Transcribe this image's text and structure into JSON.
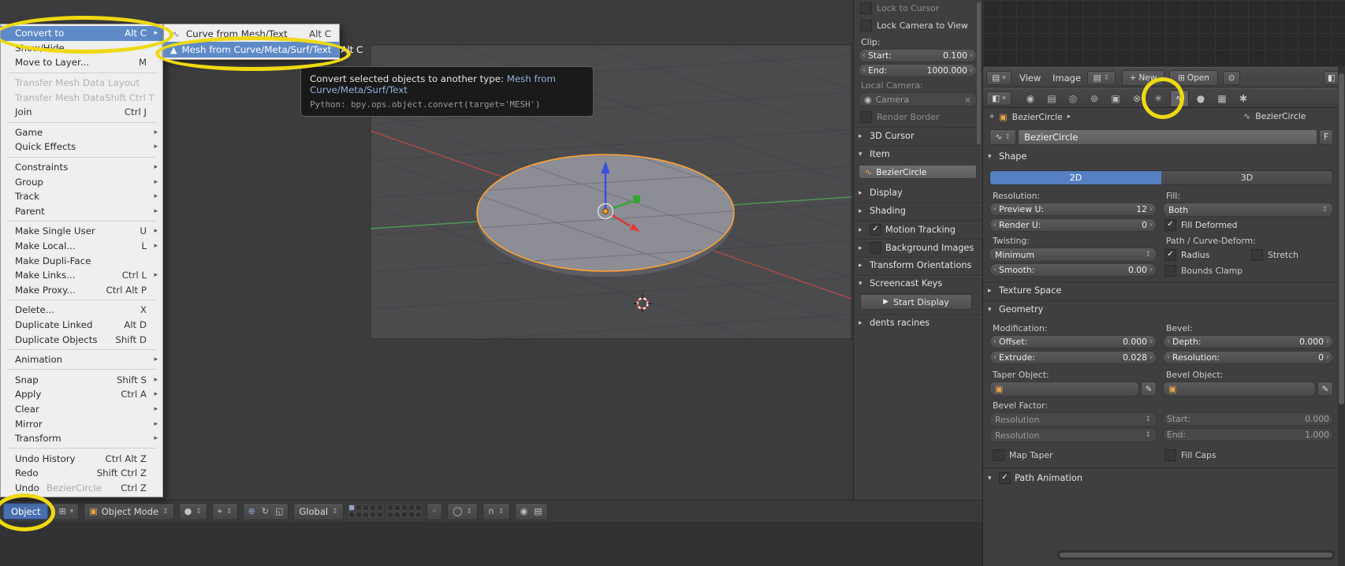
{
  "colors": {
    "accent_blue": "#5680c2",
    "highlight_yellow": "#eed912",
    "selection_orange": "#ffa231",
    "menu_bg": "#efefef",
    "panel_bg": "#3f3f42"
  },
  "object_menu": {
    "items": [
      {
        "label": "Convert to",
        "shortcut": "Alt C",
        "submenu": true,
        "selected": true
      },
      {
        "label": "Show/Hide"
      },
      {
        "label": "Move to Layer...",
        "shortcut": "M"
      },
      {
        "sep": true
      },
      {
        "label": "Transfer Mesh Data Layout",
        "disabled": true
      },
      {
        "label": "Transfer Mesh Data",
        "shortcut": "Shift Ctrl T",
        "disabled": true
      },
      {
        "label": "Join",
        "shortcut": "Ctrl J"
      },
      {
        "sep": true
      },
      {
        "label": "Game",
        "submenu": true
      },
      {
        "label": "Quick Effects",
        "submenu": true
      },
      {
        "sep": true
      },
      {
        "label": "Constraints",
        "submenu": true
      },
      {
        "label": "Group",
        "submenu": true
      },
      {
        "label": "Track",
        "submenu": true
      },
      {
        "label": "Parent",
        "submenu": true
      },
      {
        "sep": true
      },
      {
        "label": "Make Single User",
        "shortcut": "U",
        "submenu": true
      },
      {
        "label": "Make Local...",
        "shortcut": "L",
        "submenu": true
      },
      {
        "label": "Make Dupli-Face"
      },
      {
        "label": "Make Links...",
        "shortcut": "Ctrl L",
        "submenu": true
      },
      {
        "label": "Make Proxy...",
        "shortcut": "Ctrl Alt P"
      },
      {
        "sep": true
      },
      {
        "label": "Delete...",
        "shortcut": "X"
      },
      {
        "label": "Duplicate Linked",
        "shortcut": "Alt D"
      },
      {
        "label": "Duplicate Objects",
        "shortcut": "Shift D"
      },
      {
        "sep": true
      },
      {
        "label": "Animation",
        "submenu": true
      },
      {
        "sep": true
      },
      {
        "label": "Snap",
        "shortcut": "Shift S",
        "submenu": true
      },
      {
        "label": "Apply",
        "shortcut": "Ctrl A",
        "submenu": true
      },
      {
        "label": "Clear",
        "submenu": true
      },
      {
        "label": "Mirror",
        "submenu": true
      },
      {
        "label": "Transform",
        "submenu": true
      },
      {
        "sep": true
      },
      {
        "label": "Undo History",
        "shortcut": "Ctrl Alt Z"
      },
      {
        "label": "Redo",
        "shortcut": "Shift Ctrl Z"
      },
      {
        "label": "Undo",
        "ghost": "BezierCircle",
        "shortcut": "Ctrl Z"
      }
    ]
  },
  "convert_submenu": {
    "items": [
      {
        "label": "Curve from Mesh/Text",
        "shortcut": "Alt C",
        "icon": "curve-icon",
        "glyph": "∿"
      },
      {
        "label": "Mesh from Curve/Meta/Surf/Text",
        "shortcut": "Alt C",
        "icon": "mesh-icon",
        "glyph": "▲",
        "selected": true
      }
    ]
  },
  "tooltip": {
    "title": "Convert selected objects to another type:",
    "value": "Mesh from Curve/Meta/Surf/Text",
    "python": "Python: bpy.ops.object.convert(target='MESH')"
  },
  "n_panel": {
    "lock_to_cursor": "Lock to Cursor",
    "lock_camera_to_view": "Lock Camera to View",
    "clip_label": "Clip:",
    "start_label": "Start:",
    "start_value": "0.100",
    "end_label": "End:",
    "end_value": "1000.000",
    "local_camera_label": "Local Camera:",
    "camera_value": "Camera",
    "render_border": "Render Border",
    "cursor_3d": "3D Cursor",
    "item": "Item",
    "item_name": "BezierCircle",
    "display": "Display",
    "shading": "Shading",
    "motion_tracking": "Motion Tracking",
    "background_images": "Background Images",
    "transform_orientations": "Transform Orientations",
    "screencast_keys": "Screencast Keys",
    "start_display": "Start Display",
    "dents_racines": "dents racines"
  },
  "image_editor": {
    "view": "View",
    "image": "Image",
    "new_label": "New",
    "open_label": "Open"
  },
  "properties": {
    "tabs": [
      {
        "name": "render",
        "glyph": "◉"
      },
      {
        "name": "render-layers",
        "glyph": "▤"
      },
      {
        "name": "scene",
        "glyph": "◎"
      },
      {
        "name": "world",
        "glyph": "⊚"
      },
      {
        "name": "object",
        "glyph": "▣"
      },
      {
        "name": "constraints",
        "glyph": "⊗"
      },
      {
        "name": "modifiers",
        "glyph": "✳"
      },
      {
        "name": "object-data-curve",
        "glyph": "∿",
        "active": true
      },
      {
        "name": "material",
        "glyph": "●"
      },
      {
        "name": "texture",
        "glyph": "▦"
      },
      {
        "name": "particles",
        "glyph": "✱"
      }
    ],
    "breadcrumb": {
      "object": "BezierCircle",
      "data": "BezierCircle"
    },
    "id_name": "BezierCircle",
    "fake_user": "F",
    "shape": {
      "title": "Shape",
      "btn_2d": "2D",
      "btn_3d": "3D",
      "resolution_label": "Resolution:",
      "fill_label": "Fill:",
      "preview_u_label": "Preview U:",
      "preview_u_value": "12",
      "render_u_label": "Render U:",
      "render_u_value": "0",
      "fill_value": "Both",
      "fill_deformed": "Fill Deformed",
      "twisting_label": "Twisting:",
      "path_deform_label": "Path / Curve-Deform:",
      "twist_value": "Minimum",
      "radius": "Radius",
      "stretch": "Stretch",
      "smooth_label": "Smooth:",
      "smooth_value": "0.00",
      "bounds_clamp": "Bounds Clamp"
    },
    "texture_space": "Texture Space",
    "geometry": {
      "title": "Geometry",
      "modification_label": "Modification:",
      "bevel_label": "Bevel:",
      "offset_label": "Offset:",
      "offset_value": "0.000",
      "extrude_label": "Extrude:",
      "extrude_value": "0.028",
      "depth_label": "Depth:",
      "depth_value": "0.000",
      "resolution_label": "Resolution:",
      "resolution_value": "0",
      "taper_object_label": "Taper Object:",
      "bevel_object_label": "Bevel Object:",
      "bevel_factor_label": "Bevel Factor:",
      "factor_start_type": "Resolution",
      "factor_start_label": "Start:",
      "factor_start_value": "0.000",
      "factor_end_type": "Resolution",
      "factor_end_label": "End:",
      "factor_end_value": "1.000",
      "map_taper": "Map Taper",
      "fill_caps": "Fill Caps"
    },
    "path_animation": "Path Animation"
  },
  "vp_header": {
    "object_button": "Object",
    "mode": "Object Mode",
    "orientation": "Global"
  }
}
